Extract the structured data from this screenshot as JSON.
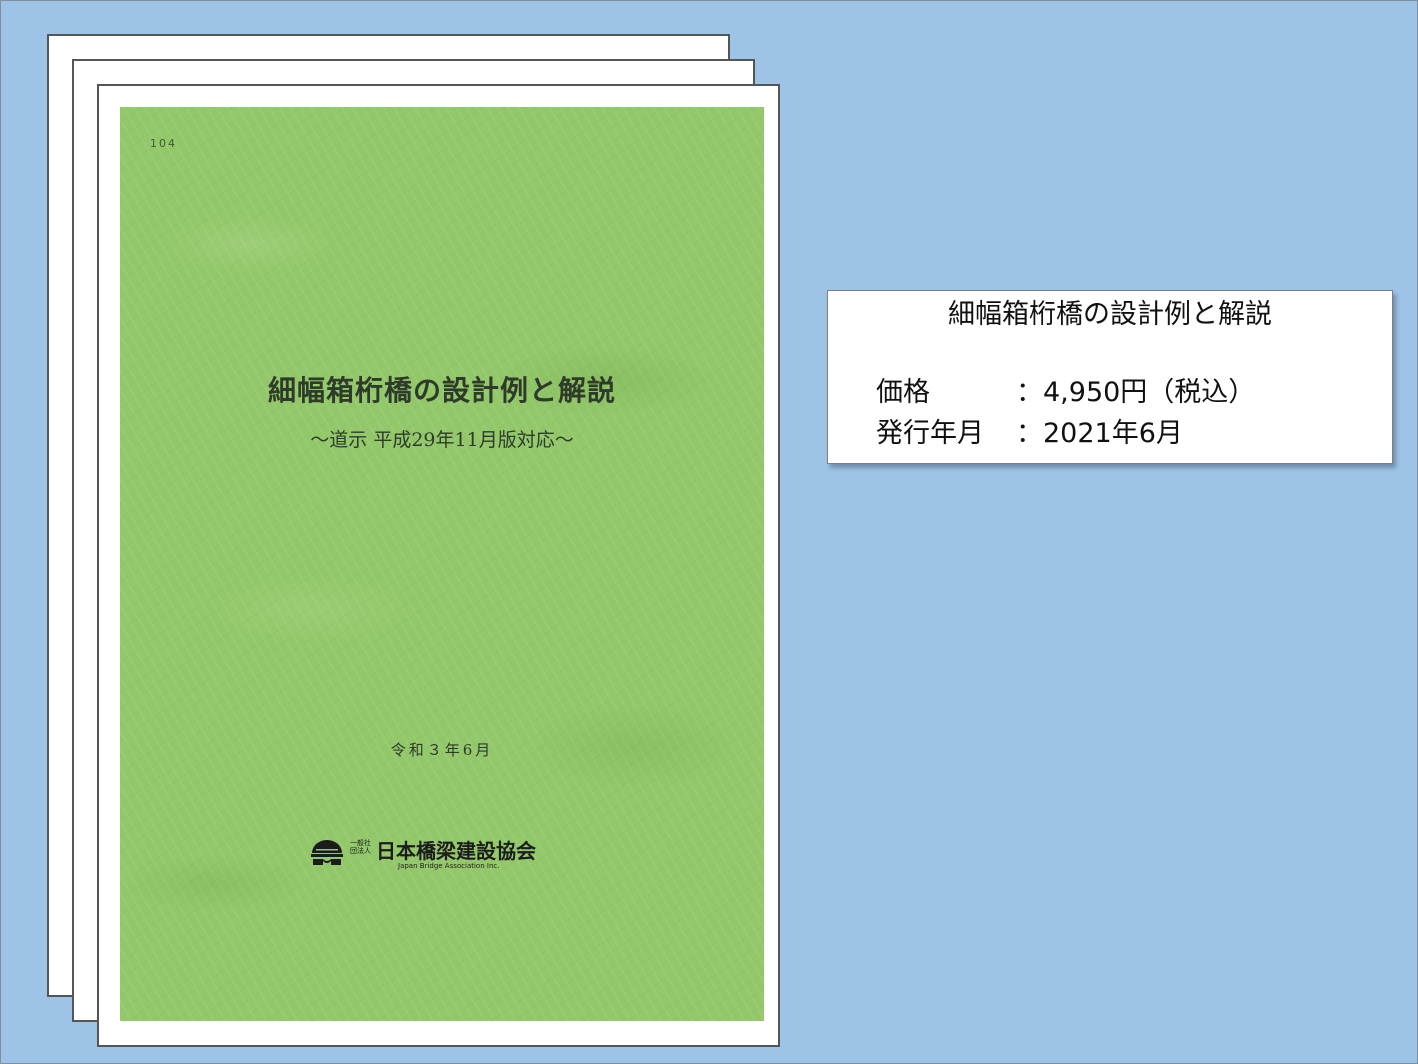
{
  "book_cover": {
    "code": "104",
    "title": "細幅箱桁橋の設計例と解説",
    "subtitle": "～道示 平成29年11月版対応～",
    "date": "令和３年6月",
    "publisher": {
      "small_text": "一般社団法人",
      "name": "日本橋梁建設協会",
      "english_name": "Japan Bridge Association Inc."
    },
    "cover_color": "#93c86a"
  },
  "info_box": {
    "title": "細幅箱桁橋の設計例と解説",
    "price_label": "価格",
    "price_value": "：4,950円（税込）",
    "date_label": "発行年月",
    "date_value": "：2021年6月"
  },
  "colors": {
    "background": "#9dc3e6",
    "info_box": "#ffffff"
  }
}
